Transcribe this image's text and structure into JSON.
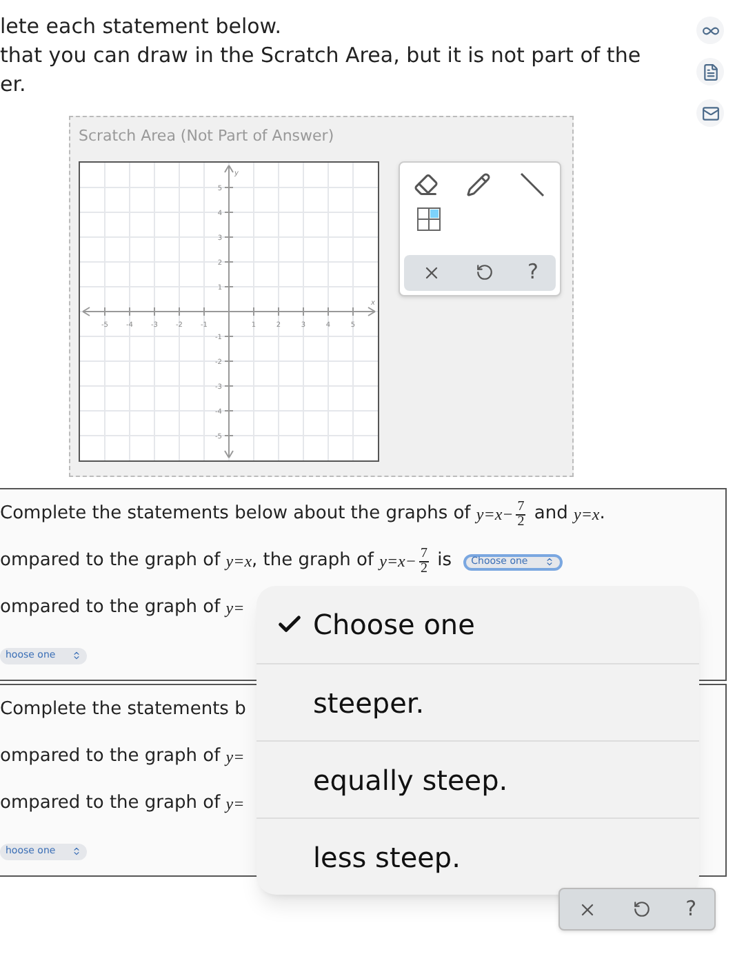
{
  "instructions": [
    "lete each statement below.",
    "that you can draw in the Scratch Area, but it is not part of the",
    "er."
  ],
  "scratch": {
    "title": "Scratch Area (Not Part of Answer)",
    "graph": {
      "x_axis": "x",
      "y_axis": "y",
      "x_labels": [
        "-5",
        "-4",
        "-3",
        "-2",
        "-1",
        "1",
        "2",
        "3",
        "4",
        "5"
      ],
      "y_labels": [
        "5",
        "4",
        "3",
        "2",
        "1",
        "-1",
        "-2",
        "-3",
        "-4",
        "-5"
      ]
    },
    "help": "?"
  },
  "questions": [
    {
      "lines": [
        [
          {
            "kind": "text",
            "text": "Complete the statements below about the graphs of "
          },
          {
            "kind": "math",
            "text": "y=x−"
          },
          {
            "kind": "frac",
            "num": "7",
            "den": "2"
          },
          {
            "kind": "text",
            "text": " and "
          },
          {
            "kind": "math",
            "text": "y=x"
          },
          {
            "kind": "text",
            "text": "."
          }
        ],
        [
          {
            "kind": "text",
            "text": "ompared to the graph of "
          },
          {
            "kind": "math",
            "text": "y=x"
          },
          {
            "kind": "text",
            "text": ", the graph of "
          },
          {
            "kind": "math",
            "text": "y=x−"
          },
          {
            "kind": "frac",
            "num": "7",
            "den": "2"
          },
          {
            "kind": "text",
            "text": " is "
          },
          {
            "kind": "select",
            "text": "Choose one",
            "focused": true
          }
        ],
        [
          {
            "kind": "text",
            "text": "ompared to the graph of "
          },
          {
            "kind": "math",
            "text": "y="
          }
        ],
        [
          {
            "kind": "select",
            "text": "hoose one",
            "focused": false
          }
        ]
      ]
    },
    {
      "lines": [
        [
          {
            "kind": "text",
            "text": "Complete the statements b"
          }
        ],
        [
          {
            "kind": "text",
            "text": "ompared to the graph of "
          },
          {
            "kind": "math",
            "text": "y="
          }
        ],
        [
          {
            "kind": "text",
            "text": "ompared to the graph of "
          },
          {
            "kind": "math",
            "text": "y="
          }
        ],
        [
          {
            "kind": "select",
            "text": "hoose one",
            "focused": false
          }
        ]
      ]
    }
  ],
  "dropdown": {
    "options": [
      {
        "label": "Choose one",
        "selected": true
      },
      {
        "label": "steeper.",
        "selected": false
      },
      {
        "label": "equally steep.",
        "selected": false
      },
      {
        "label": "less steep.",
        "selected": false
      }
    ]
  },
  "bottom_toolbar": {
    "help": "?"
  }
}
